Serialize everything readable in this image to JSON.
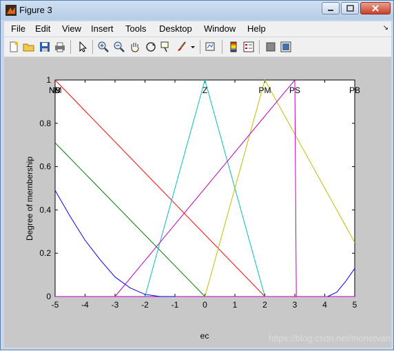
{
  "window": {
    "title": "Figure 3",
    "menu": [
      "File",
      "Edit",
      "View",
      "Insert",
      "Tools",
      "Desktop",
      "Window",
      "Help"
    ],
    "menu_overflow_icon": "pin-arrow-icon",
    "toolbar_icons": [
      "new-figure-icon",
      "open-file-icon",
      "save-icon",
      "print-icon",
      "pointer-arrow-icon",
      "zoom-in-icon",
      "zoom-out-icon",
      "pan-hand-icon",
      "rotate-3d-icon",
      "data-cursor-icon",
      "brush-icon",
      "brush-dropdown-icon",
      "link-plot-icon",
      "colorbar-icon",
      "legend-icon",
      "hide-plot-tools-icon",
      "show-plot-tools-icon"
    ]
  },
  "watermark": "https://blog.csdn.net/monetvan",
  "chart_data": {
    "type": "line",
    "xlabel": "ec",
    "ylabel": "Degree of membership",
    "xlim": [
      -5,
      5
    ],
    "ylim": [
      0,
      1
    ],
    "x_ticks": [
      -5,
      -4,
      -3,
      -2,
      -1,
      0,
      1,
      2,
      3,
      4,
      5
    ],
    "y_ticks": [
      0,
      0.2,
      0.4,
      0.6,
      0.8,
      1
    ],
    "y_tick_labels": [
      "0",
      "0.2",
      "0.4",
      "0.6",
      "0.8",
      "1"
    ],
    "grid": false,
    "mf_labels": [
      {
        "text": "NB",
        "x": -5
      },
      {
        "text": "NM",
        "x": -5
      },
      {
        "text": "NS",
        "x": -5
      },
      {
        "text": "Z",
        "x": 0
      },
      {
        "text": "PM",
        "x": 2
      },
      {
        "text": "PS",
        "x": 3
      },
      {
        "text": "PB",
        "x": 5
      }
    ],
    "series": [
      {
        "name": "NB",
        "color": "#0000ff",
        "shape": "curve",
        "x": [
          -5,
          -4.5,
          -4,
          -3.5,
          -3,
          -2.5,
          -2,
          -1.5,
          -1
        ],
        "y": [
          0.49,
          0.37,
          0.26,
          0.17,
          0.09,
          0.04,
          0.01,
          0,
          0
        ]
      },
      {
        "name": "NM",
        "color": "#008000",
        "shape": "polyline",
        "x": [
          -5,
          0
        ],
        "y": [
          0.71,
          0
        ]
      },
      {
        "name": "NS",
        "color": "#ff0000",
        "shape": "polyline",
        "x": [
          -5,
          2
        ],
        "y": [
          1,
          0
        ]
      },
      {
        "name": "Z",
        "color": "#00bfbf",
        "shape": "polyline",
        "x": [
          -2,
          0,
          2
        ],
        "y": [
          0,
          1,
          0
        ]
      },
      {
        "name": "PM",
        "color": "#bfbf00",
        "shape": "polyline",
        "x": [
          0,
          2,
          5
        ],
        "y": [
          0,
          1,
          0.25
        ]
      },
      {
        "name": "PS",
        "color": "#bf00bf",
        "shape": "polyline",
        "x": [
          -3,
          3,
          3.05
        ],
        "y": [
          0,
          1,
          0
        ]
      },
      {
        "name": "PB",
        "color": "#0000ff",
        "shape": "curve",
        "x": [
          4.1,
          4.4,
          4.7,
          5
        ],
        "y": [
          0,
          0.02,
          0.07,
          0.13
        ]
      }
    ]
  }
}
